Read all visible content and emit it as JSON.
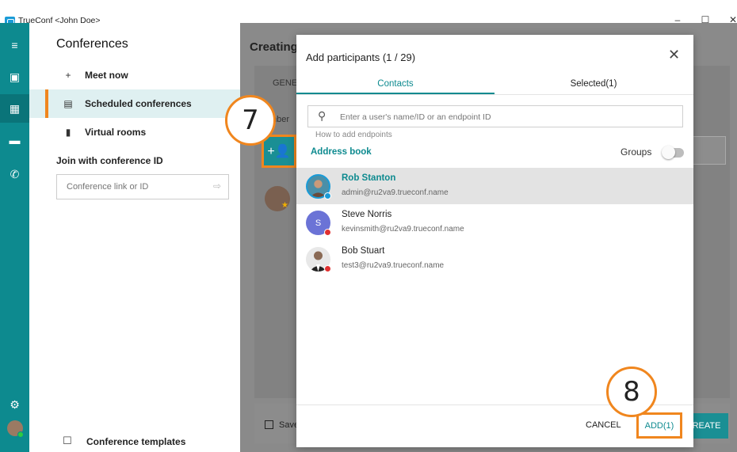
{
  "window": {
    "title": "TrueConf <John Doe>",
    "controls": [
      "–",
      "☐",
      "✕"
    ]
  },
  "rail": {
    "items": [
      {
        "icon": "menu-icon",
        "glyph": "≡"
      },
      {
        "icon": "contacts-icon",
        "glyph": "▣"
      },
      {
        "icon": "conferences-icon",
        "glyph": "▦",
        "active": true
      },
      {
        "icon": "chat-icon",
        "glyph": "▬"
      },
      {
        "icon": "call-history-icon",
        "glyph": "✆"
      }
    ],
    "settings_glyph": "⚙"
  },
  "sidebar": {
    "title": "Conferences",
    "items": [
      {
        "label": "Meet now",
        "glyph": "+"
      },
      {
        "label": "Scheduled conferences",
        "glyph": "▤",
        "active": true
      },
      {
        "label": "Virtual rooms",
        "glyph": "▮"
      }
    ],
    "join_label": "Join with conference ID",
    "join_placeholder": "Conference link or ID",
    "join_arrow": "⇨",
    "templates_label": "Conference templates",
    "templates_glyph": "☐"
  },
  "main": {
    "title": "Creating",
    "tab": "GENE",
    "members_label": "mber",
    "add_member_glyph": "+👤",
    "save_label": "Save",
    "create_label": "REATE"
  },
  "callouts": [
    "7",
    "8"
  ],
  "dialog": {
    "title": "Add participants (1 / 29)",
    "close_glyph": "✕",
    "tabs": [
      {
        "label": "Contacts",
        "active": true
      },
      {
        "label": "Selected(1)",
        "active": false
      }
    ],
    "search_placeholder": "Enter a user's name/ID or an endpoint ID",
    "how_to": "How to add endpoints",
    "address_book": "Address book",
    "groups_label": "Groups",
    "groups_enabled": false,
    "contacts": [
      {
        "name": "Rob Stanton",
        "email": "admin@ru2va9.trueconf.name",
        "selected": true,
        "avatar_color": "#4a8fa8",
        "avatar_text": "",
        "status_color": "#1a9bd7"
      },
      {
        "name": "Steve Norris",
        "email": "kevinsmith@ru2va9.trueconf.name",
        "selected": false,
        "avatar_color": "#6b73d6",
        "avatar_text": "S",
        "status_color": "#e03030"
      },
      {
        "name": "Bob Stuart",
        "email": "test3@ru2va9.trueconf.name",
        "selected": false,
        "avatar_color": "#3a3a3a",
        "avatar_text": "",
        "status_color": "#e03030"
      }
    ],
    "cancel_label": "CANCEL",
    "add_label": "ADD(1)"
  }
}
